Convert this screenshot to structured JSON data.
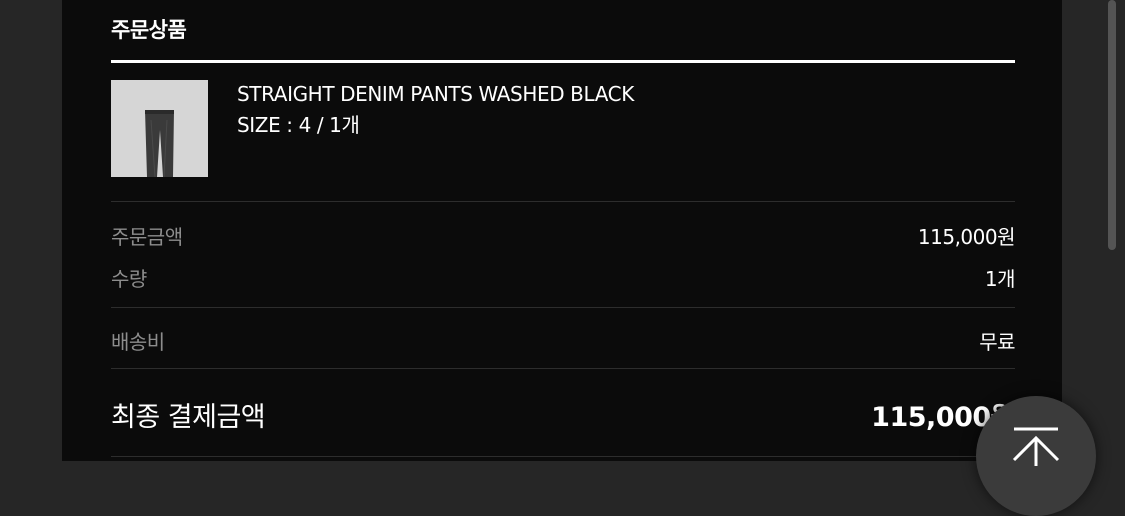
{
  "section": {
    "title": "주문상품"
  },
  "product": {
    "name": "STRAIGHT DENIM PANTS WASHED BLACK",
    "option": "SIZE : 4 / 1개",
    "thumbnail_icon": "denim-pants-image"
  },
  "summary": {
    "order_amount_label": "주문금액",
    "order_amount_value": "115,000원",
    "quantity_label": "수량",
    "quantity_value": "1개",
    "shipping_label": "배송비",
    "shipping_value": "무료",
    "total_label": "최종 결제금액",
    "total_value": "115,000원"
  },
  "controls": {
    "scroll_top_icon": "arrow-up-to-top-icon"
  },
  "colors": {
    "page_background": "#262626",
    "panel_background": "#0b0b0b",
    "text_primary": "#ffffff",
    "text_secondary": "#8d8d8d",
    "divider": "#2d2d2d",
    "floating_button": "#3b3b3b"
  }
}
